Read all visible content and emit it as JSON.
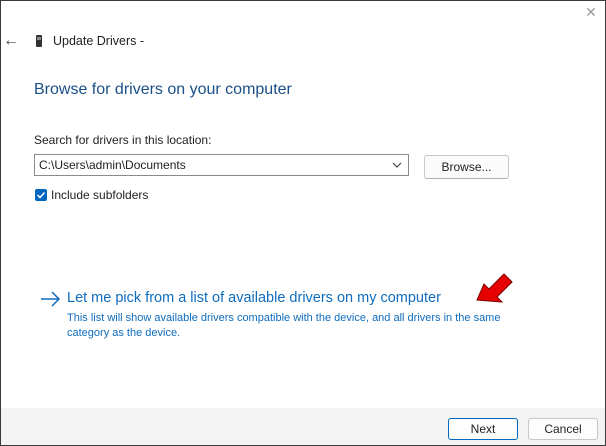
{
  "window": {
    "close_glyph": "✕",
    "back_glyph": "←",
    "title": "Update Drivers -",
    "device_icon": "device-icon"
  },
  "main": {
    "heading": "Browse for drivers on your computer",
    "search_label": "Search for drivers in this location:",
    "path_value": "C:\\Users\\admin\\Documents",
    "browse_label": "Browse...",
    "include_subfolders_label": "Include subfolders",
    "include_subfolders_checked": true,
    "pick_link": {
      "title": "Let me pick from a list of available drivers on my computer",
      "description": "This list will show available drivers compatible with the device, and all drivers in the same category as the device."
    }
  },
  "footer": {
    "next_label": "Next",
    "cancel_label": "Cancel"
  },
  "colors": {
    "heading": "#1b4f87",
    "link": "#0f6cbd",
    "checkbox": "#0067c0",
    "annotation_arrow": "#e60000"
  }
}
